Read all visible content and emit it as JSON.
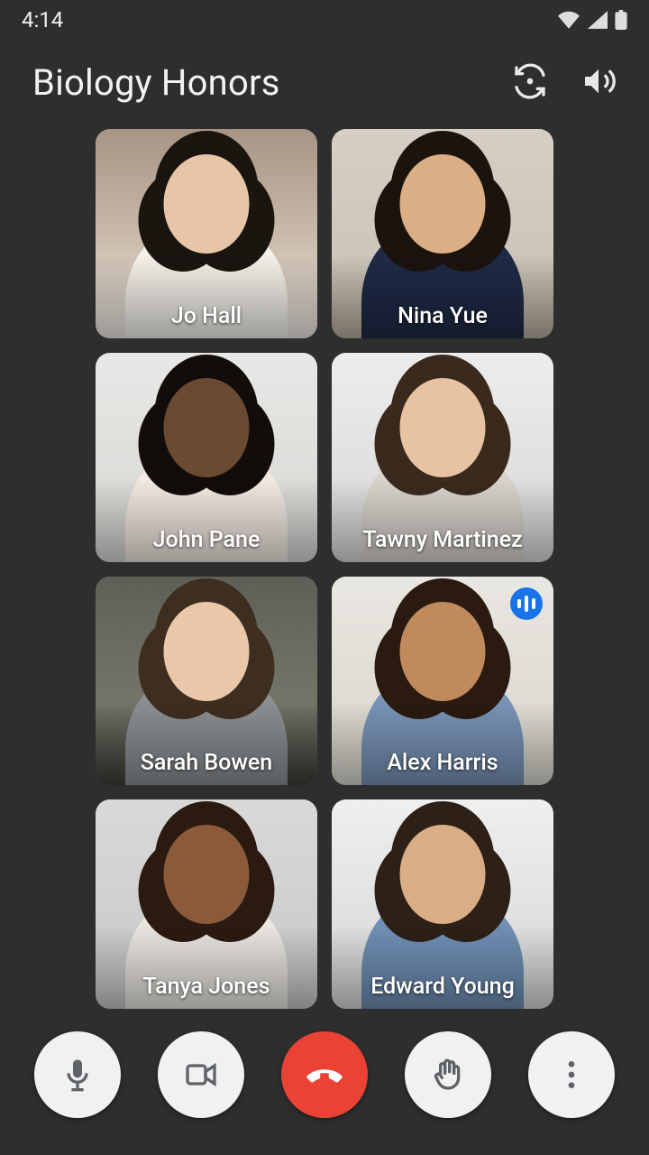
{
  "status": {
    "time": "4:14"
  },
  "header": {
    "title": "Biology Honors"
  },
  "participants": [
    {
      "name": "Jo Hall",
      "speaking": false
    },
    {
      "name": "Nina Yue",
      "speaking": false
    },
    {
      "name": "John Pane",
      "speaking": false
    },
    {
      "name": "Tawny Martinez",
      "speaking": false
    },
    {
      "name": "Sarah Bowen",
      "speaking": false
    },
    {
      "name": "Alex Harris",
      "speaking": true
    },
    {
      "name": "Tanya Jones",
      "speaking": false
    },
    {
      "name": "Edward Young",
      "speaking": false
    }
  ],
  "avatar_style": [
    {
      "hair": "#1b1510",
      "skin": "#e7c6a8",
      "shirt": "#f4f1ea"
    },
    {
      "hair": "#1a130e",
      "skin": "#dcae86",
      "shirt": "#1f2a47"
    },
    {
      "hair": "#120d0a",
      "skin": "#6b4a32",
      "shirt": "#f2e9e2"
    },
    {
      "hair": "#3a2a1d",
      "skin": "#e7c3a3",
      "shirt": "#d8d4cd"
    },
    {
      "hair": "#3e2e20",
      "skin": "#eac7a9",
      "shirt": "#8b8f92"
    },
    {
      "hair": "#2a1a10",
      "skin": "#c08a5d",
      "shirt": "#7893b6"
    },
    {
      "hair": "#2b1a10",
      "skin": "#8a5a3b",
      "shirt": "#e9e6e0"
    },
    {
      "hair": "#2c2017",
      "skin": "#d9ae86",
      "shirt": "#6f8fb4"
    }
  ],
  "colors": {
    "hangup": "#ea4335",
    "speaking_badge": "#1a73e8"
  }
}
